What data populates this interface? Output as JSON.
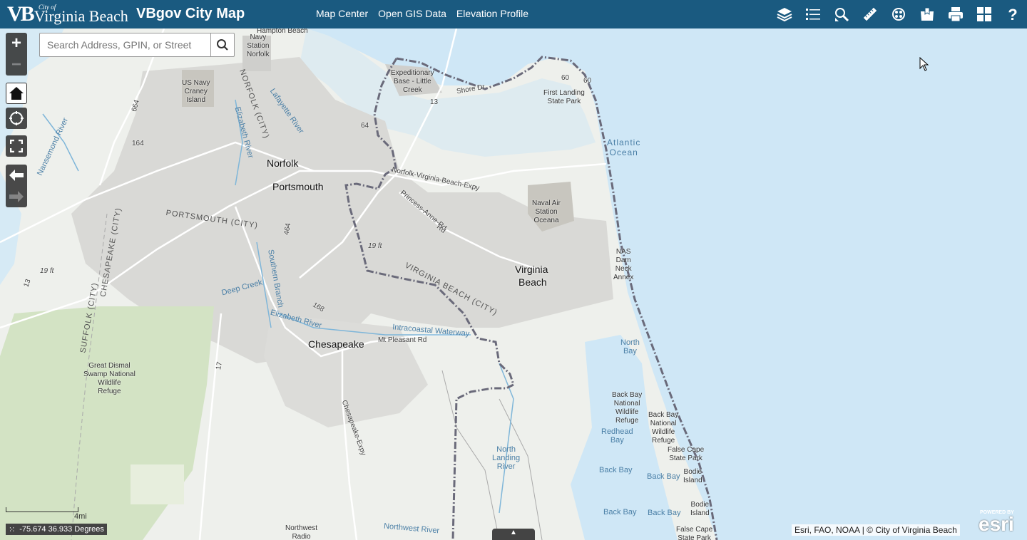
{
  "header": {
    "logo_vb": "VB",
    "logo_cityof": "City of",
    "logo_name": "Virginia Beach",
    "app_title": "VBgov City Map",
    "nav": [
      "Map Center",
      "Open GIS Data",
      "Elevation Profile"
    ],
    "tools": [
      "layers-icon",
      "legend-list-icon",
      "identify-search-icon",
      "measure-ruler-icon",
      "basemap-gallery-icon",
      "bookmarks-icon",
      "print-icon",
      "widgets-grid-icon",
      "help-icon"
    ],
    "bg_color": "#1a5a80"
  },
  "search": {
    "placeholder": "Search Address, GPIN, or Street"
  },
  "controls": {
    "zoom_in": "+",
    "zoom_out": "−"
  },
  "scale": {
    "label": "4mi"
  },
  "coords": {
    "text": "-75.674 36.933 Degrees"
  },
  "attribution": "Esri, FAO, NOAA | © City of Virginia Beach",
  "esri": {
    "powered": "POWERED BY",
    "logo": "esri"
  },
  "map_labels": {
    "cities": [
      "Norfolk",
      "Portsmouth",
      "Virginia",
      "Beach",
      "Chesapeake"
    ],
    "places": [
      "Navy",
      "Station",
      "Norfolk",
      "US Navy",
      "Craney",
      "Island",
      "Expeditionary",
      "Base - Little",
      "Creek",
      "First Landing",
      "State Park",
      "Naval Air",
      "Station",
      "Oceana",
      "NAS",
      "Dam",
      "Neck",
      "Annex",
      "Great Dismal",
      "Swamp National",
      "Wildlife",
      "Refuge",
      "Back Bay",
      "National",
      "Wildlife",
      "Refuge",
      "Back Bay",
      "National",
      "Wildlife",
      "Refuge",
      "False",
      "Cape",
      "State Park",
      "Bodie",
      "Island",
      "Bodie",
      "Island",
      "False Cape",
      "State Park",
      "Northwest",
      "Radio",
      "Hampton Beach"
    ],
    "water": [
      "Atlantic",
      "Ocean",
      "North",
      "Bay",
      "Redhead",
      "Bay",
      "Back Bay",
      "Back Bay",
      "Back Bay",
      "Back Bay",
      "North",
      "Landing",
      "River",
      "Deep Creek",
      "Elizabeth River",
      "Intracoastal Waterway",
      "Lafayette River",
      "Elizabeth River",
      "Southern Branch",
      "Nansemond River",
      "Northwest River"
    ],
    "roads": [
      "Shore Dr",
      "60",
      "60",
      "13",
      "64",
      "Norfolk-Virginia-Beach-Expy",
      "Princess-Anne-Rd",
      "Mt Pleasant Rd",
      "Chesapeake-Expy",
      "164",
      "664",
      "464",
      "168",
      "17",
      "13",
      "19 ft",
      "19 ft",
      "Rd"
    ],
    "counties": [
      "NORFOLK (CITY)",
      "PORTSMOUTH (CITY)",
      "VIRGINIA BEACH (CITY)",
      "CHESAPEAKE (CITY)",
      "SUFFOLK (CITY)"
    ]
  },
  "colors": {
    "land": "#eef0ec",
    "urban": "#d9d9d6",
    "water": "#cfe7f6",
    "park": "#d3e3c4",
    "boundary": "#6a6a7a"
  }
}
